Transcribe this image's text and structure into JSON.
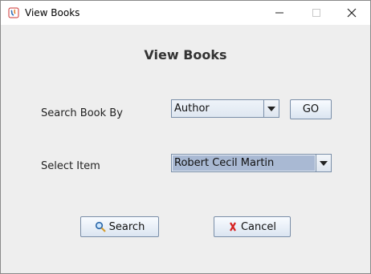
{
  "window": {
    "title": "View Books"
  },
  "heading": "View Books",
  "form": {
    "search_by_label": "Search Book By",
    "search_by_value": "Author",
    "go_label": "GO",
    "select_item_label": "Select Item",
    "select_item_value": "Robert Cecil Martin"
  },
  "buttons": {
    "search_label": "Search",
    "cancel_label": "Cancel"
  },
  "icons": {
    "search": "magnifier-icon",
    "cancel": "red-x-icon"
  }
}
